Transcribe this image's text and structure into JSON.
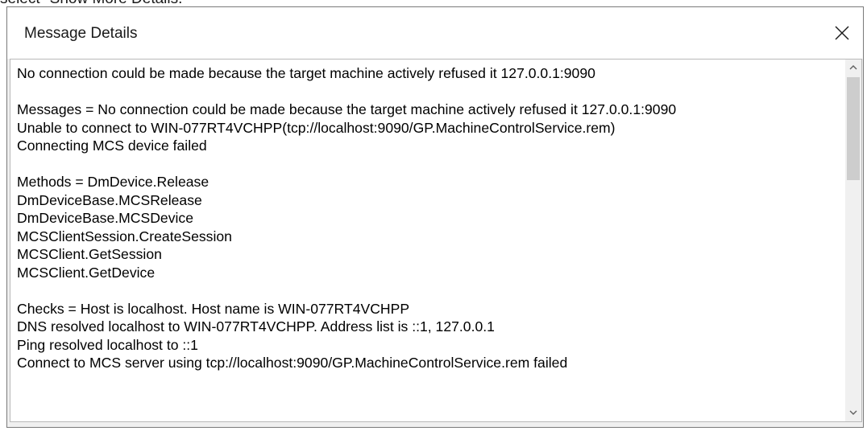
{
  "page": {
    "caption": "select \"Show More Details.\""
  },
  "dialog": {
    "title": "Message Details",
    "close_glyph": "close-icon",
    "lines": [
      "No connection could be made because the target machine actively refused it 127.0.0.1:9090",
      "",
      "Messages = No connection could be made because the target machine actively refused it 127.0.0.1:9090",
      "Unable to connect to WIN-077RT4VCHPP(tcp://localhost:9090/GP.MachineControlService.rem)",
      "Connecting MCS device failed",
      "",
      "Methods = DmDevice.Release",
      "DmDeviceBase.MCSRelease",
      "DmDeviceBase.MCSDevice",
      "MCSClientSession.CreateSession",
      "MCSClient.GetSession",
      "MCSClient.GetDevice",
      "",
      "Checks = Host is localhost. Host name is WIN-077RT4VCHPP",
      "DNS resolved localhost to WIN-077RT4VCHPP. Address list is ::1, 127.0.0.1",
      "Ping resolved localhost to ::1",
      "Connect to MCS server using tcp://localhost:9090/GP.MachineControlService.rem failed"
    ],
    "scrollbar": {
      "up_icon": "chevron-up-icon",
      "down_icon": "chevron-down-icon"
    }
  }
}
